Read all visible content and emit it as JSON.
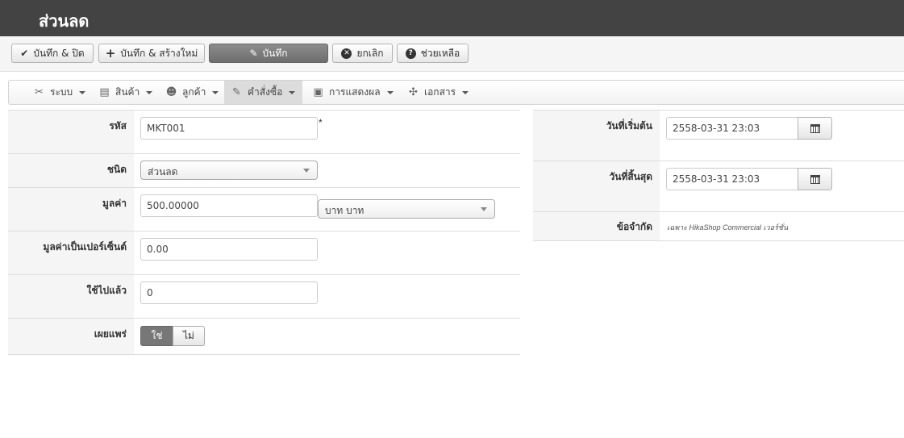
{
  "header": {
    "title": "ส่วนลด"
  },
  "toolbar": {
    "save_close": "บันทึก & ปิด",
    "save_new": "บันทึก & สร้างใหม่",
    "save": "บันทึก",
    "cancel": "ยกเลิก",
    "help": "ช่วยเหลือ"
  },
  "menu": {
    "system": "ระบบ",
    "products": "สินค้า",
    "customers": "ลูกค้า",
    "orders": "คำสั่งซื้อ",
    "display": "การแสดงผล",
    "documents": "เอกสาร"
  },
  "form": {
    "code": {
      "label": "รหัส",
      "value": "MKT001",
      "required_mark": "*"
    },
    "type": {
      "label": "ชนิด",
      "value": "ส่วนลด"
    },
    "value": {
      "label": "มูลค่า",
      "value": "500.00000",
      "currency": "บาท บาท"
    },
    "percent": {
      "label": "มูลค่าเป็นเปอร์เซ็นต์",
      "value": "0.00"
    },
    "used": {
      "label": "ใช้ไปแล้ว",
      "value": "0"
    },
    "published": {
      "label": "เผยแพร่",
      "yes": "ใช่",
      "no": "ไม่",
      "selected": "yes"
    },
    "start_date": {
      "label": "วันที่เริ่มต้น",
      "value": "2558-03-31 23:03"
    },
    "end_date": {
      "label": "วันที่สิ้นสุด",
      "value": "2558-03-31 23:03"
    },
    "restrictions": {
      "label": "ข้อจำกัด",
      "note": "เฉพาะ HikaShop Commercial เวอร์ชั่น"
    }
  },
  "colors": {
    "header_bg": "#434343",
    "primary_button": "#7a7a7a",
    "label_bg": "#f5f5f5"
  }
}
